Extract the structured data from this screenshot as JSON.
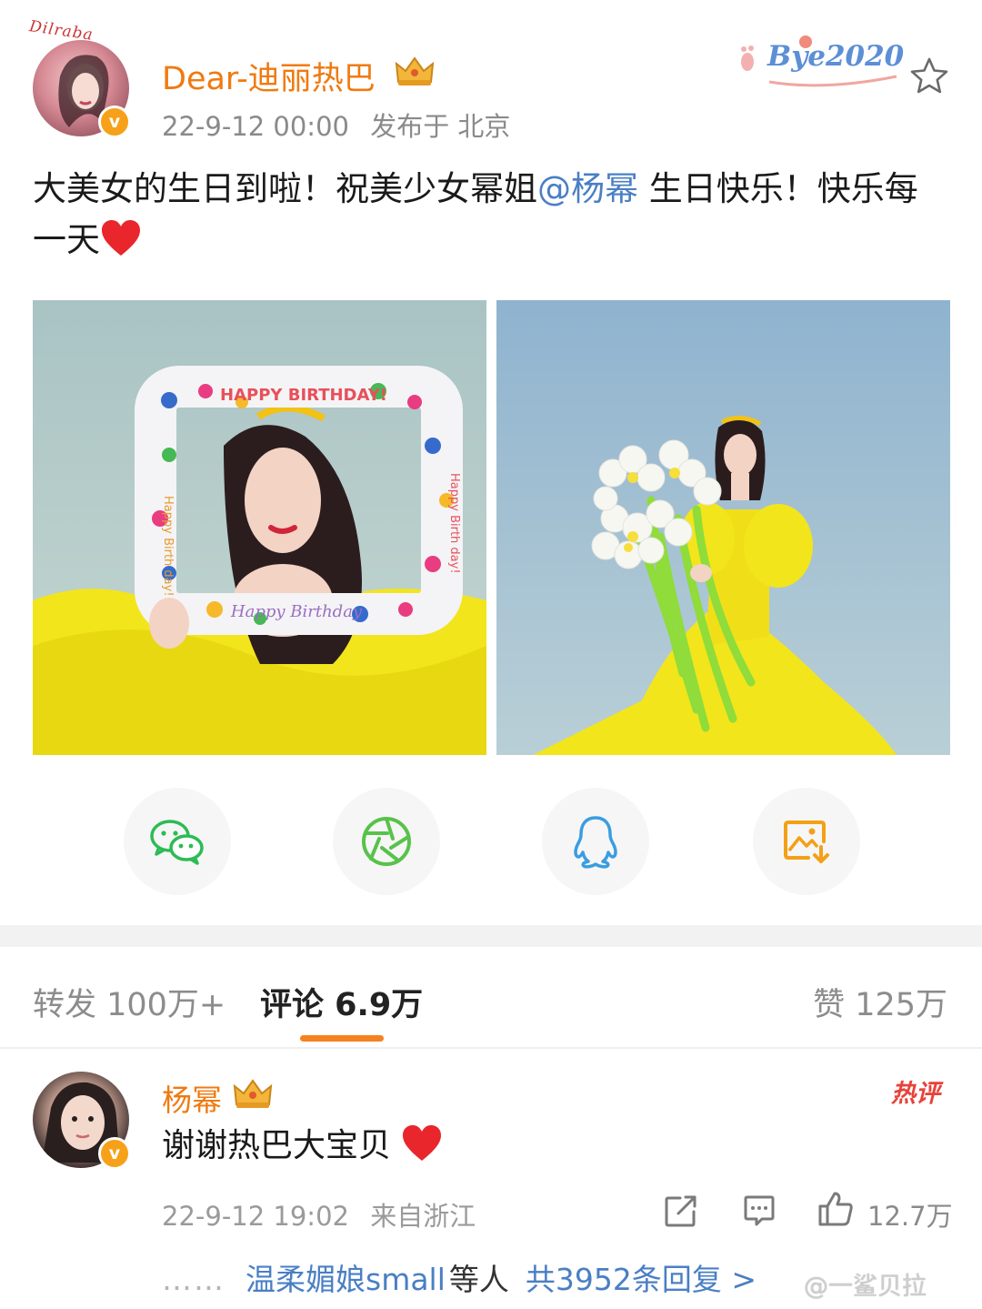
{
  "post": {
    "username": "Dear-迪丽热巴",
    "time": "22-9-12 00:00",
    "location": "发布于 北京",
    "badge_text": "Bye2020",
    "avatar_deco_text": "Dilraba",
    "verified_mark": "v",
    "text_before": "大美女的生日到啦！祝美少女幂姐",
    "mention": "@杨幂",
    "text_after": " 生日快乐！快乐每一天",
    "photo1_balloon_top": "HAPPY BIRTHDAY!",
    "photo1_balloon_left": "Happy Birth day!",
    "photo1_balloon_right": "Happy Birth day!",
    "photo1_balloon_bottom": "Happy Birthday"
  },
  "share": {
    "items": [
      "wechat-icon",
      "moments-icon",
      "qq-icon",
      "save-image-icon"
    ]
  },
  "tabs": {
    "repost": "转发 100万+",
    "comment": "评论 6.9万",
    "like": "赞 125万"
  },
  "comment": {
    "username": "杨幂",
    "verified_mark": "v",
    "hot_label": "热评",
    "text": "谢谢热巴大宝贝",
    "time": "22-9-12 19:02",
    "location": "来自浙江",
    "like_count": "12.7万",
    "replies_dots": "……",
    "replies_names": "温柔媚娘small",
    "replies_suffix": "等人",
    "replies_link": "共3952条回复 >"
  },
  "watermark": "@一鲨贝拉",
  "colors": {
    "accent_orange": "#f07a10",
    "link_blue": "#4a7fc4",
    "tab_underline": "#f5821f",
    "hot_red": "#e8423a",
    "verified_badge": "#f7a11a"
  }
}
